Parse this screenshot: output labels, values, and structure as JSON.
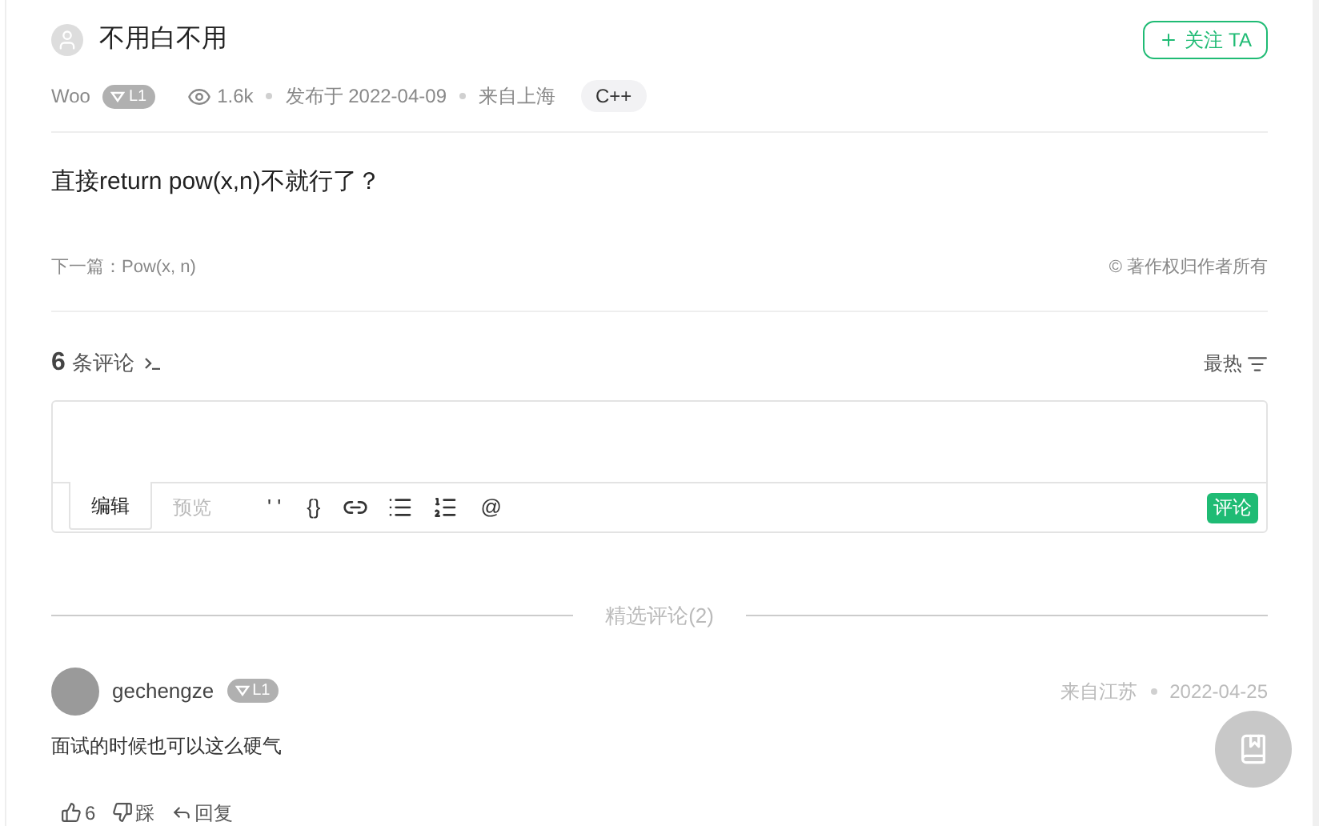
{
  "post": {
    "author": "不用白不用",
    "follow_button": "关注 TA",
    "username": "Woo",
    "level": "L1",
    "views": "1.6k",
    "published": "发布于 2022-04-09",
    "location": "来自上海",
    "tag": "C++",
    "body": "直接return pow(x,n)不就行了？",
    "next_label": "下一篇：Pow(x, n)",
    "copyright": "© 著作权归作者所有"
  },
  "comments_header": {
    "count": "6",
    "label": "条评论",
    "sort": "最热"
  },
  "editor": {
    "tabs": [
      {
        "label": "编辑",
        "selected": true
      },
      {
        "label": "预览",
        "selected": false
      }
    ],
    "toolbar": [
      {
        "kind": "text",
        "label": "' '"
      },
      {
        "kind": "text",
        "label": "{}"
      },
      {
        "kind": "link"
      },
      {
        "kind": "bullets"
      },
      {
        "kind": "numbers"
      },
      {
        "kind": "text",
        "label": "@"
      }
    ],
    "submit": "评论"
  },
  "featured_divider": "精选评论(2)",
  "comments": [
    {
      "username": "gechengze",
      "level": "L1",
      "location": "来自江苏",
      "date": "2022-04-25",
      "text": "面试的时候也可以这么硬气",
      "likes": "6",
      "dislike": "踩",
      "reply": "回复"
    }
  ]
}
